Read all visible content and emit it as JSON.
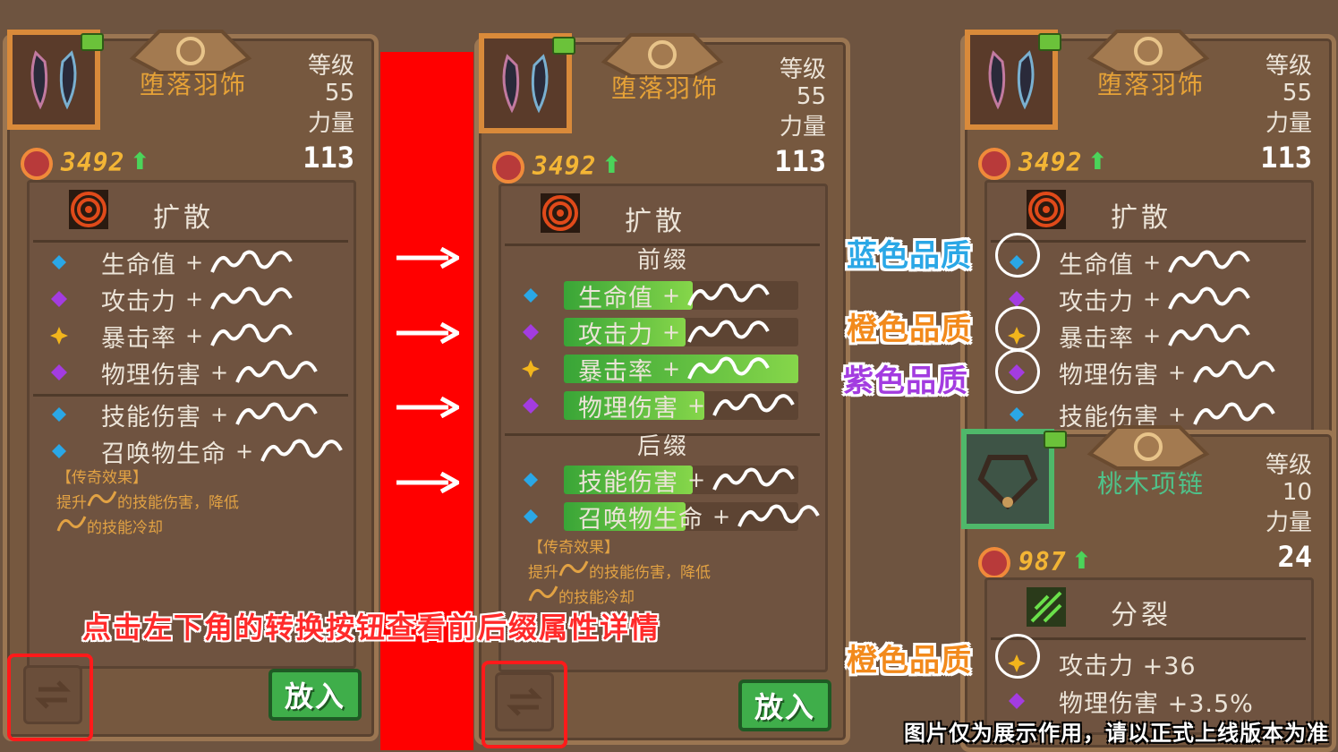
{
  "panel_left": {
    "item_name": "堕落羽饰",
    "level_label": "等级",
    "level_value": "55",
    "attr_label": "力量",
    "attr_value": "113",
    "power": "3492",
    "skill_name": "扩散",
    "stats": [
      {
        "label": "生命值",
        "gem": "blue",
        "plus": "+"
      },
      {
        "label": "攻击力",
        "gem": "purple",
        "plus": "+"
      },
      {
        "label": "暴击率",
        "gem": "orange",
        "plus": "+"
      },
      {
        "label": "物理伤害",
        "gem": "purple",
        "plus": "+"
      },
      {
        "label": "技能伤害",
        "gem": "blue",
        "plus": "+"
      },
      {
        "label": "召唤物生命",
        "gem": "blue",
        "plus": "+"
      }
    ],
    "legend_title": "【传奇效果】",
    "legend_line1_a": "提升",
    "legend_line1_b": "的技能伤害，降低",
    "legend_line2": "的技能冷却",
    "put_button": "放入"
  },
  "panel_mid": {
    "item_name": "堕落羽饰",
    "level_label": "等级",
    "level_value": "55",
    "attr_label": "力量",
    "attr_value": "113",
    "power": "3492",
    "skill_name": "扩散",
    "prefix_title": "前缀",
    "suffix_title": "后缀",
    "prefix_stats": [
      {
        "label": "生命值",
        "gem": "blue",
        "plus": "+",
        "fill": 0.55
      },
      {
        "label": "攻击力",
        "gem": "purple",
        "plus": "+",
        "fill": 0.52
      },
      {
        "label": "暴击率",
        "gem": "orange",
        "plus": "+",
        "fill": 1.0
      },
      {
        "label": "物理伤害",
        "gem": "purple",
        "plus": "+",
        "fill": 0.6
      }
    ],
    "suffix_stats": [
      {
        "label": "技能伤害",
        "gem": "blue",
        "plus": "+",
        "fill": 0.55
      },
      {
        "label": "召唤物生命",
        "gem": "blue",
        "plus": "+",
        "fill": 0.52
      }
    ],
    "legend_title": "【传奇效果】",
    "legend_line1_a": "提升",
    "legend_line1_b": "的技能伤害，降低",
    "legend_line2": "的技能冷却",
    "put_button": "放入"
  },
  "panel_right": {
    "item_name": "堕落羽饰",
    "level_label": "等级",
    "level_value": "55",
    "attr_label": "力量",
    "attr_value": "113",
    "power": "3492",
    "skill_name": "扩散",
    "stats": [
      {
        "label": "生命值",
        "gem": "blue",
        "plus": "+"
      },
      {
        "label": "攻击力",
        "gem": "purple",
        "plus": "+"
      },
      {
        "label": "暴击率",
        "gem": "orange",
        "plus": "+"
      },
      {
        "label": "物理伤害",
        "gem": "purple",
        "plus": "+"
      },
      {
        "label": "技能伤害",
        "gem": "blue",
        "plus": "+"
      }
    ]
  },
  "panel_necklace": {
    "item_name": "桃木项链",
    "level_label": "等级",
    "level_value": "10",
    "attr_label": "力量",
    "attr_value": "24",
    "power": "987",
    "skill_name": "分裂",
    "stats": [
      {
        "label": "攻击力 +36",
        "gem": "orange"
      },
      {
        "label": "物理伤害 +3.5%",
        "gem": "purple"
      }
    ]
  },
  "quality_labels": {
    "blue": "蓝色品质",
    "orange": "橙色品质",
    "purple": "紫色品质",
    "orange2": "橙色品质"
  },
  "instruction": "点击左下角的转换按钮查看前后缀属性详情",
  "disclaimer": "图片仅为展示作用，请以正式上线版本为准",
  "colors": {
    "blue_quality": "#2aa7e6",
    "orange_quality": "#f28a1c",
    "purple_quality": "#a33ce0",
    "instruction_red": "#ff2a2a",
    "item_name_orange": "#e6a237",
    "item_name_green": "#4fc28a"
  }
}
